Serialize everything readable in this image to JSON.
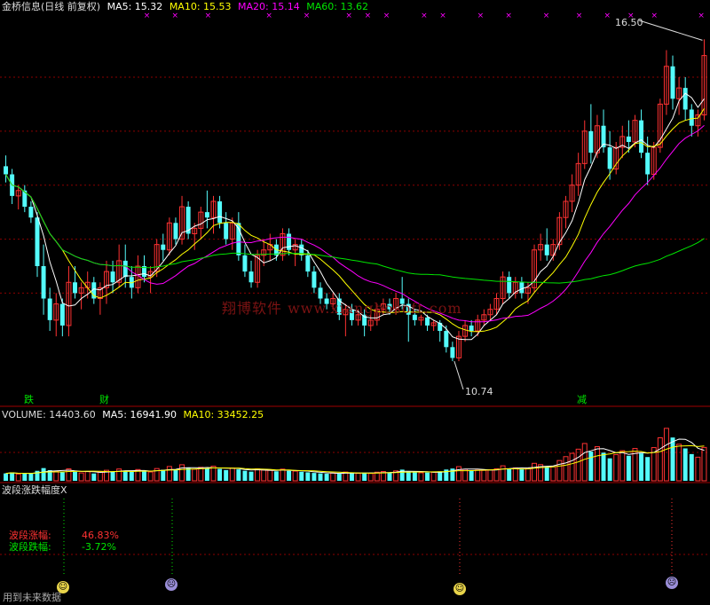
{
  "header": {
    "title": "金桥信息(日线 前复权)",
    "ma5": "MA5: 15.32",
    "ma10": "MA10: 15.53",
    "ma20": "MA20: 15.14",
    "ma60": "MA60: 13.62"
  },
  "annotations": {
    "high": "16.50",
    "low": "10.74",
    "watermark": "翔博软件  www.xiangbosoft.com",
    "mark_die": "跌",
    "mark_cai": "财",
    "mark_jian": "减",
    "wave_up_label": "波段涨幅:",
    "wave_up_value": "46.83%",
    "wave_down_label": "波段跌幅:",
    "wave_down_value": "-3.72%",
    "footer": "用到未来数据"
  },
  "volume_header": {
    "volume": "VOLUME: 14403.60",
    "ma5": "MA5: 16941.90",
    "ma10": "MA10: 33452.25"
  },
  "indicator_title": "波段涨跌幅度X",
  "colors": {
    "up": "#ff3232",
    "down": "#54fcfc",
    "ma5": "#ffffff",
    "ma10": "#ffff00",
    "ma20": "#ff00ff",
    "ma60": "#00e600",
    "grid": "#8b0000",
    "marker": "#ff00ff"
  },
  "chart_data": {
    "type": "candlestick",
    "price_range": [
      10.2,
      17.1
    ],
    "volume_range": [
      0,
      75000
    ],
    "candles": [
      {
        "o": 14.35,
        "h": 14.55,
        "l": 14.05,
        "c": 14.2
      },
      {
        "o": 14.2,
        "h": 14.3,
        "l": 13.65,
        "c": 13.8
      },
      {
        "o": 13.8,
        "h": 14.0,
        "l": 13.55,
        "c": 13.9
      },
      {
        "o": 13.9,
        "h": 14.0,
        "l": 13.5,
        "c": 13.6
      },
      {
        "o": 13.6,
        "h": 13.7,
        "l": 13.3,
        "c": 13.4
      },
      {
        "o": 13.4,
        "h": 13.5,
        "l": 12.3,
        "c": 12.5
      },
      {
        "o": 12.5,
        "h": 12.9,
        "l": 11.6,
        "c": 11.9
      },
      {
        "o": 11.9,
        "h": 12.1,
        "l": 11.3,
        "c": 11.5
      },
      {
        "o": 11.5,
        "h": 12.0,
        "l": 11.2,
        "c": 11.8
      },
      {
        "o": 11.8,
        "h": 11.9,
        "l": 11.2,
        "c": 11.4
      },
      {
        "o": 11.4,
        "h": 12.5,
        "l": 11.2,
        "c": 12.2
      },
      {
        "o": 12.2,
        "h": 12.5,
        "l": 11.9,
        "c": 12.0
      },
      {
        "o": 12.0,
        "h": 12.2,
        "l": 11.7,
        "c": 12.1
      },
      {
        "o": 12.1,
        "h": 12.4,
        "l": 11.9,
        "c": 12.2
      },
      {
        "o": 12.2,
        "h": 12.3,
        "l": 11.8,
        "c": 11.9
      },
      {
        "o": 11.9,
        "h": 12.2,
        "l": 11.6,
        "c": 12.1
      },
      {
        "o": 12.1,
        "h": 12.6,
        "l": 11.8,
        "c": 12.4
      },
      {
        "o": 12.4,
        "h": 12.6,
        "l": 12.0,
        "c": 12.2
      },
      {
        "o": 12.2,
        "h": 12.9,
        "l": 12.1,
        "c": 12.6
      },
      {
        "o": 12.6,
        "h": 12.9,
        "l": 12.1,
        "c": 12.3
      },
      {
        "o": 12.3,
        "h": 12.5,
        "l": 11.9,
        "c": 12.1
      },
      {
        "o": 12.1,
        "h": 12.7,
        "l": 12.0,
        "c": 12.5
      },
      {
        "o": 12.5,
        "h": 12.7,
        "l": 12.2,
        "c": 12.3
      },
      {
        "o": 12.3,
        "h": 12.5,
        "l": 12.0,
        "c": 12.4
      },
      {
        "o": 12.4,
        "h": 13.0,
        "l": 12.3,
        "c": 12.9
      },
      {
        "o": 12.9,
        "h": 13.1,
        "l": 12.6,
        "c": 12.8
      },
      {
        "o": 12.8,
        "h": 13.4,
        "l": 12.7,
        "c": 13.3
      },
      {
        "o": 13.3,
        "h": 13.4,
        "l": 12.9,
        "c": 13.0
      },
      {
        "o": 13.0,
        "h": 13.8,
        "l": 12.9,
        "c": 13.6
      },
      {
        "o": 13.6,
        "h": 13.7,
        "l": 13.0,
        "c": 13.1
      },
      {
        "o": 13.1,
        "h": 13.3,
        "l": 12.8,
        "c": 13.2
      },
      {
        "o": 13.2,
        "h": 13.6,
        "l": 13.0,
        "c": 13.5
      },
      {
        "o": 13.5,
        "h": 13.9,
        "l": 13.2,
        "c": 13.4
      },
      {
        "o": 13.4,
        "h": 13.8,
        "l": 13.1,
        "c": 13.7
      },
      {
        "o": 13.7,
        "h": 13.8,
        "l": 13.2,
        "c": 13.3
      },
      {
        "o": 13.3,
        "h": 13.5,
        "l": 12.9,
        "c": 13.0
      },
      {
        "o": 13.0,
        "h": 13.4,
        "l": 12.8,
        "c": 13.3
      },
      {
        "o": 13.3,
        "h": 13.5,
        "l": 12.6,
        "c": 12.7
      },
      {
        "o": 12.7,
        "h": 12.9,
        "l": 12.3,
        "c": 12.4
      },
      {
        "o": 12.4,
        "h": 12.6,
        "l": 12.1,
        "c": 12.2
      },
      {
        "o": 12.2,
        "h": 12.8,
        "l": 12.1,
        "c": 12.7
      },
      {
        "o": 12.7,
        "h": 13.0,
        "l": 12.5,
        "c": 12.8
      },
      {
        "o": 12.8,
        "h": 13.1,
        "l": 12.6,
        "c": 12.9
      },
      {
        "o": 12.9,
        "h": 13.0,
        "l": 12.6,
        "c": 12.7
      },
      {
        "o": 12.7,
        "h": 13.2,
        "l": 12.6,
        "c": 13.1
      },
      {
        "o": 13.1,
        "h": 13.2,
        "l": 12.7,
        "c": 12.8
      },
      {
        "o": 12.8,
        "h": 13.0,
        "l": 12.5,
        "c": 12.9
      },
      {
        "o": 12.9,
        "h": 13.0,
        "l": 12.6,
        "c": 12.7
      },
      {
        "o": 12.7,
        "h": 12.8,
        "l": 12.3,
        "c": 12.4
      },
      {
        "o": 12.4,
        "h": 12.5,
        "l": 12.0,
        "c": 12.1
      },
      {
        "o": 12.1,
        "h": 12.2,
        "l": 11.8,
        "c": 11.9
      },
      {
        "o": 11.9,
        "h": 12.0,
        "l": 11.7,
        "c": 11.8
      },
      {
        "o": 11.8,
        "h": 12.0,
        "l": 11.7,
        "c": 11.9
      },
      {
        "o": 11.9,
        "h": 12.0,
        "l": 11.5,
        "c": 11.6
      },
      {
        "o": 11.6,
        "h": 11.8,
        "l": 11.2,
        "c": 11.7
      },
      {
        "o": 11.7,
        "h": 11.8,
        "l": 11.4,
        "c": 11.5
      },
      {
        "o": 11.5,
        "h": 11.7,
        "l": 11.4,
        "c": 11.6
      },
      {
        "o": 11.6,
        "h": 11.7,
        "l": 11.2,
        "c": 11.4
      },
      {
        "o": 11.4,
        "h": 11.6,
        "l": 11.3,
        "c": 11.5
      },
      {
        "o": 11.5,
        "h": 11.8,
        "l": 11.4,
        "c": 11.7
      },
      {
        "o": 11.7,
        "h": 11.9,
        "l": 11.6,
        "c": 11.8
      },
      {
        "o": 11.8,
        "h": 11.9,
        "l": 11.6,
        "c": 11.7
      },
      {
        "o": 11.7,
        "h": 12.0,
        "l": 11.6,
        "c": 11.9
      },
      {
        "o": 11.9,
        "h": 12.3,
        "l": 11.7,
        "c": 11.8
      },
      {
        "o": 11.8,
        "h": 11.9,
        "l": 11.1,
        "c": 11.6
      },
      {
        "o": 11.6,
        "h": 11.7,
        "l": 11.4,
        "c": 11.5
      },
      {
        "o": 11.5,
        "h": 11.6,
        "l": 11.4,
        "c": 11.55
      },
      {
        "o": 11.55,
        "h": 11.6,
        "l": 11.3,
        "c": 11.4
      },
      {
        "o": 11.4,
        "h": 11.5,
        "l": 11.3,
        "c": 11.45
      },
      {
        "o": 11.45,
        "h": 11.5,
        "l": 11.1,
        "c": 11.3
      },
      {
        "o": 11.3,
        "h": 11.4,
        "l": 10.9,
        "c": 11.0
      },
      {
        "o": 11.0,
        "h": 11.1,
        "l": 10.74,
        "c": 10.8
      },
      {
        "o": 10.8,
        "h": 11.3,
        "l": 10.74,
        "c": 11.2
      },
      {
        "o": 11.2,
        "h": 11.5,
        "l": 11.1,
        "c": 11.4
      },
      {
        "o": 11.4,
        "h": 11.5,
        "l": 11.2,
        "c": 11.3
      },
      {
        "o": 11.3,
        "h": 11.6,
        "l": 11.2,
        "c": 11.5
      },
      {
        "o": 11.5,
        "h": 11.7,
        "l": 11.4,
        "c": 11.6
      },
      {
        "o": 11.6,
        "h": 11.8,
        "l": 11.5,
        "c": 11.7
      },
      {
        "o": 11.7,
        "h": 12.0,
        "l": 11.6,
        "c": 11.9
      },
      {
        "o": 11.9,
        "h": 12.4,
        "l": 11.8,
        "c": 12.3
      },
      {
        "o": 12.3,
        "h": 12.4,
        "l": 11.9,
        "c": 12.0
      },
      {
        "o": 12.0,
        "h": 12.3,
        "l": 11.9,
        "c": 12.2
      },
      {
        "o": 12.2,
        "h": 12.3,
        "l": 11.9,
        "c": 12.0
      },
      {
        "o": 12.0,
        "h": 12.2,
        "l": 11.8,
        "c": 12.1
      },
      {
        "o": 12.1,
        "h": 12.9,
        "l": 12.0,
        "c": 12.8
      },
      {
        "o": 12.8,
        "h": 13.1,
        "l": 12.6,
        "c": 12.9
      },
      {
        "o": 12.9,
        "h": 13.2,
        "l": 12.6,
        "c": 12.7
      },
      {
        "o": 12.7,
        "h": 13.0,
        "l": 12.6,
        "c": 12.9
      },
      {
        "o": 12.9,
        "h": 13.5,
        "l": 12.8,
        "c": 13.4
      },
      {
        "o": 13.4,
        "h": 13.8,
        "l": 13.2,
        "c": 13.7
      },
      {
        "o": 13.7,
        "h": 14.2,
        "l": 13.5,
        "c": 14.0
      },
      {
        "o": 14.0,
        "h": 14.6,
        "l": 13.8,
        "c": 14.4
      },
      {
        "o": 14.4,
        "h": 15.2,
        "l": 14.3,
        "c": 15.0
      },
      {
        "o": 15.0,
        "h": 15.5,
        "l": 14.4,
        "c": 14.6
      },
      {
        "o": 14.6,
        "h": 15.3,
        "l": 14.5,
        "c": 15.1
      },
      {
        "o": 15.1,
        "h": 15.4,
        "l": 14.6,
        "c": 14.7
      },
      {
        "o": 14.7,
        "h": 15.0,
        "l": 14.1,
        "c": 14.3
      },
      {
        "o": 14.3,
        "h": 14.8,
        "l": 14.2,
        "c": 14.7
      },
      {
        "o": 14.7,
        "h": 15.1,
        "l": 14.5,
        "c": 14.9
      },
      {
        "o": 14.9,
        "h": 15.2,
        "l": 14.6,
        "c": 14.8
      },
      {
        "o": 14.8,
        "h": 15.3,
        "l": 14.7,
        "c": 15.2
      },
      {
        "o": 15.2,
        "h": 15.4,
        "l": 14.5,
        "c": 14.6
      },
      {
        "o": 14.6,
        "h": 14.9,
        "l": 14.0,
        "c": 14.2
      },
      {
        "o": 14.2,
        "h": 14.8,
        "l": 14.1,
        "c": 14.7
      },
      {
        "o": 14.7,
        "h": 15.6,
        "l": 14.6,
        "c": 15.5
      },
      {
        "o": 15.5,
        "h": 16.5,
        "l": 15.3,
        "c": 16.2
      },
      {
        "o": 16.2,
        "h": 16.4,
        "l": 15.4,
        "c": 15.6
      },
      {
        "o": 15.6,
        "h": 16.0,
        "l": 15.3,
        "c": 15.8
      },
      {
        "o": 15.8,
        "h": 16.0,
        "l": 15.2,
        "c": 15.4
      },
      {
        "o": 15.4,
        "h": 15.5,
        "l": 14.9,
        "c": 15.1
      },
      {
        "o": 15.1,
        "h": 15.4,
        "l": 14.9,
        "c": 15.3
      },
      {
        "o": 15.3,
        "h": 16.7,
        "l": 15.2,
        "c": 16.4
      }
    ],
    "volumes": [
      9800,
      11200,
      8900,
      10100,
      9500,
      13200,
      16800,
      14100,
      12600,
      11300,
      15800,
      11900,
      10400,
      12100,
      9700,
      11800,
      13900,
      12200,
      15600,
      13400,
      11800,
      14900,
      12300,
      11700,
      16200,
      14600,
      18900,
      14300,
      21200,
      17100,
      15200,
      17800,
      16400,
      19300,
      15700,
      14200,
      16900,
      15100,
      13300,
      12100,
      15800,
      14400,
      13900,
      12600,
      15400,
      13100,
      12800,
      11900,
      11200,
      10400,
      9800,
      9400,
      10200,
      9300,
      11600,
      10100,
      9900,
      10800,
      9700,
      11400,
      12300,
      10900,
      13100,
      14800,
      12100,
      11100,
      10600,
      10900,
      11400,
      12500,
      14900,
      16200,
      18700,
      15100,
      13200,
      14100,
      13800,
      14600,
      15900,
      19800,
      16300,
      17100,
      15800,
      16400,
      23100,
      21400,
      19200,
      18600,
      26800,
      31900,
      36300,
      41800,
      49300,
      38600,
      45100,
      37200,
      29700,
      34600,
      39800,
      33100,
      42700,
      36200,
      31400,
      43900,
      56800,
      69300,
      57200,
      48300,
      42800,
      35300,
      31200,
      44100
    ],
    "ma_last": {
      "ma5": 15.32,
      "ma10": 15.53,
      "ma20": 15.14,
      "ma60": 13.62
    },
    "volume_ma_last": {
      "ma5": 16941.9,
      "ma10": 33452.25
    }
  }
}
